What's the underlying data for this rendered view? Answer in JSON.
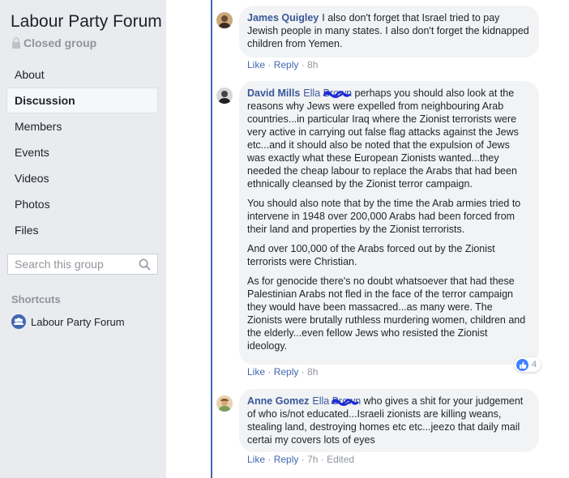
{
  "group": {
    "title": "Labour Party Forum",
    "privacy": "Closed group"
  },
  "nav": {
    "items": [
      "About",
      "Discussion",
      "Members",
      "Events",
      "Videos",
      "Photos",
      "Files"
    ],
    "active": "Discussion"
  },
  "search": {
    "placeholder": "Search this group"
  },
  "shortcuts": {
    "title": "Shortcuts",
    "items": [
      {
        "label": "Labour Party Forum"
      }
    ]
  },
  "colors": {
    "accent": "#4267b2",
    "link": "#385898",
    "muted": "#90949c",
    "bubble": "#f2f3f5"
  },
  "comments": [
    {
      "author": "James Quigley",
      "paragraphs": [
        "I also don't forget that Israel tried to pay Jewish people in many states. I also don't forget the kidnapped children from Yemen."
      ],
      "actions": {
        "like": "Like",
        "reply": "Reply",
        "time": "8h"
      }
    },
    {
      "author": "David Mills",
      "mention": "Ella Brown",
      "paragraphs": [
        "perhaps you should also look at the reasons why Jews were expelled from neighbouring Arab countries...in particular Iraq where the Zionist terrorists were very active in carrying out false flag attacks against the Jews etc...and it should also be noted that the expulsion of Jews was exactly what these European Zionists wanted...they needed the cheap labour to replace the Arabs that had been ethnically cleansed by the Zionist terror campaign.",
        "You should also note that by the time the Arab armies tried to intervene in 1948 over 200,000 Arabs had been forced from their land and properties by the Zionist terrorists.",
        "And over 100,000 of the Arabs forced out by the Zionist terrorists were Christian.",
        "As for genocide there's no doubt whatsoever that had these Palestinian Arabs not fled in the face of the terror campaign they would have been massacred...as many were. The Zionists were brutally ruthless murdering women, children and the elderly...even fellow Jews who resisted the Zionist ideology."
      ],
      "reaction_count": "4",
      "actions": {
        "like": "Like",
        "reply": "Reply",
        "time": "8h"
      }
    },
    {
      "author": "Anne Gomez",
      "mention": "Ella Brown",
      "paragraphs": [
        "who gives a shit for your judgement of who is/not educated...Israeli zionists are killing weans, stealing land, destroying homes etc etc...jeezo that daily mail certai my covers lots of eyes"
      ],
      "actions": {
        "like": "Like",
        "reply": "Reply",
        "time": "7h",
        "edited": "Edited"
      }
    }
  ]
}
